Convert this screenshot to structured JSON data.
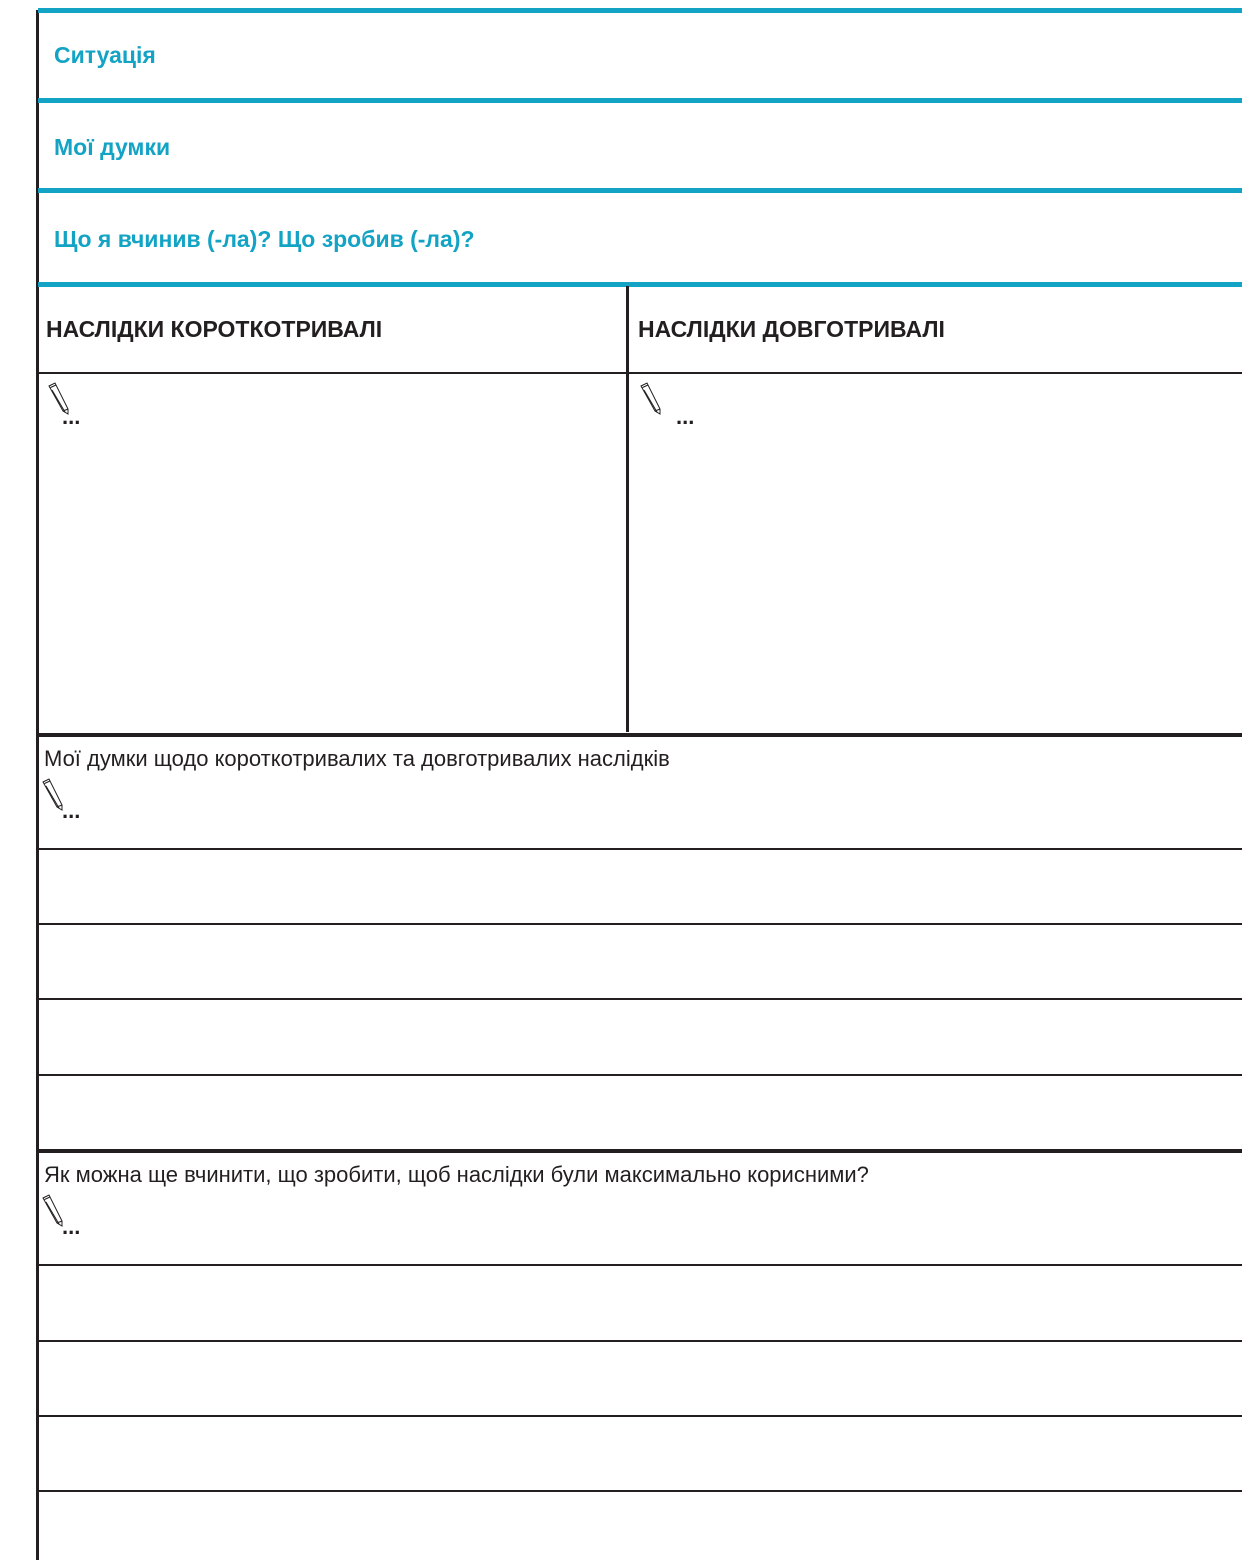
{
  "colors": {
    "accent": "#13a3c4",
    "ink": "#231f20"
  },
  "sections": {
    "situation": "Ситуація",
    "my_thoughts": "Мої думки",
    "what_did": "Що я вчинив (-ла)? Що зробив (-ла)?"
  },
  "consequences": {
    "short_header": "НАСЛІДКИ КОРОТКОТРИВАЛІ",
    "long_header": "НАСЛІДКИ ДОВГОТРИВАЛІ",
    "short_placeholder": "...",
    "long_placeholder": "..."
  },
  "reflection": {
    "label": "Мої думки щодо короткотривалих та довготривалих наслідків",
    "placeholder": "..."
  },
  "improvement": {
    "label": "Як можна ще вчинити, що зробити, щоб наслідки були максимально корисними?",
    "placeholder": "..."
  },
  "icons": {
    "write": "pencil-icon"
  }
}
